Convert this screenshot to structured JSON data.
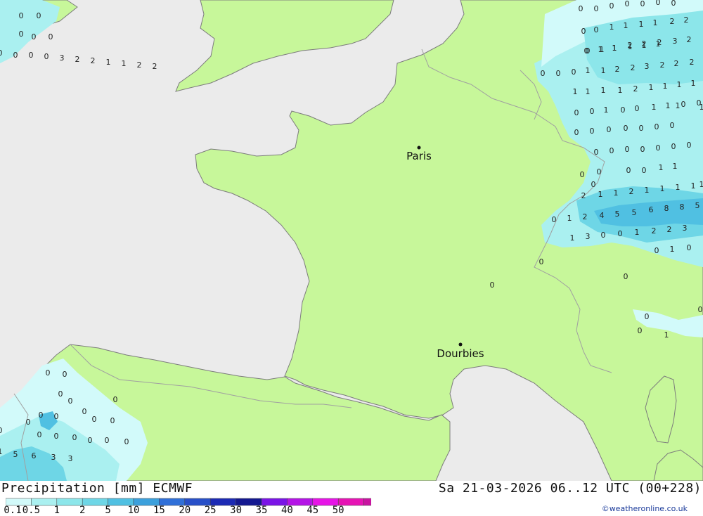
{
  "map": {
    "title": "Precipitation [mm] ECMWF",
    "run_info": "Sa 21-03-2026 06..12 UTC (00+228)",
    "credit": "©weatheronline.co.uk",
    "colors": {
      "sea": "#ebebeb",
      "land": "#c7f79a",
      "border": "#a0a0a0",
      "coast": "#7c7c7c"
    },
    "cities": [
      {
        "name": "Paris"
      },
      {
        "name": "Dourbies"
      }
    ],
    "legend": {
      "labels": [
        "0.1",
        "0.5",
        "1",
        "2",
        "5",
        "10",
        "15",
        "20",
        "25",
        "30",
        "35",
        "40",
        "45",
        "50"
      ],
      "colors": [
        "#d2fafa",
        "#aaf0f0",
        "#8ce6ea",
        "#6ed6e6",
        "#50c0e2",
        "#3ca0dc",
        "#3070d8",
        "#2850c8",
        "#1c2ab4",
        "#141890",
        "#7a14e6",
        "#b414e6",
        "#e614e6",
        "#e614b4",
        "#c814a0"
      ]
    },
    "values": [
      {
        "t": "0"
      },
      {
        "t": "0"
      },
      {
        "t": "0"
      },
      {
        "t": "0"
      },
      {
        "t": "0"
      },
      {
        "t": "0"
      },
      {
        "t": "0"
      },
      {
        "t": "0"
      },
      {
        "t": "0"
      },
      {
        "t": "1"
      },
      {
        "t": "1"
      },
      {
        "t": "1"
      },
      {
        "t": "1"
      },
      {
        "t": "0"
      },
      {
        "t": "1"
      },
      {
        "t": "1"
      },
      {
        "t": "1"
      },
      {
        "t": "1"
      },
      {
        "t": "1"
      },
      {
        "t": "2"
      },
      {
        "t": "2"
      },
      {
        "t": "0"
      },
      {
        "t": "1"
      },
      {
        "t": "1"
      },
      {
        "t": "2"
      },
      {
        "t": "2"
      },
      {
        "t": "2"
      },
      {
        "t": "3"
      },
      {
        "t": "2"
      },
      {
        "t": "0"
      },
      {
        "t": "0"
      },
      {
        "t": "0"
      },
      {
        "t": "1"
      },
      {
        "t": "1"
      },
      {
        "t": "2"
      },
      {
        "t": "2"
      },
      {
        "t": "3"
      },
      {
        "t": "2"
      },
      {
        "t": "2"
      },
      {
        "t": "2"
      },
      {
        "t": "1"
      },
      {
        "t": "1"
      },
      {
        "t": "1"
      },
      {
        "t": "1"
      },
      {
        "t": "2"
      },
      {
        "t": "1"
      },
      {
        "t": "1"
      },
      {
        "t": "1"
      },
      {
        "t": "1"
      },
      {
        "t": "1"
      },
      {
        "t": "1"
      },
      {
        "t": "0"
      },
      {
        "t": "0"
      },
      {
        "t": "1"
      },
      {
        "t": "0"
      },
      {
        "t": "0"
      },
      {
        "t": "1"
      },
      {
        "t": "1"
      },
      {
        "t": "0"
      },
      {
        "t": "0"
      },
      {
        "t": "0"
      },
      {
        "t": "0"
      },
      {
        "t": "0"
      },
      {
        "t": "0"
      },
      {
        "t": "0"
      },
      {
        "t": "0"
      },
      {
        "t": "0"
      },
      {
        "t": "0"
      },
      {
        "t": "0"
      },
      {
        "t": "0"
      },
      {
        "t": "0"
      },
      {
        "t": "0"
      },
      {
        "t": "0"
      },
      {
        "t": "0"
      },
      {
        "t": "0"
      },
      {
        "t": "0"
      },
      {
        "t": "0"
      },
      {
        "t": "0"
      },
      {
        "t": "1"
      },
      {
        "t": "1"
      },
      {
        "t": "0"
      },
      {
        "t": "2"
      },
      {
        "t": "1"
      },
      {
        "t": "1"
      },
      {
        "t": "2"
      },
      {
        "t": "1"
      },
      {
        "t": "1"
      },
      {
        "t": "1"
      },
      {
        "t": "1"
      },
      {
        "t": "1"
      },
      {
        "t": "0"
      },
      {
        "t": "1"
      },
      {
        "t": "2"
      },
      {
        "t": "4"
      },
      {
        "t": "5"
      },
      {
        "t": "5"
      },
      {
        "t": "6"
      },
      {
        "t": "8"
      },
      {
        "t": "8"
      },
      {
        "t": "5"
      },
      {
        "t": "1"
      },
      {
        "t": "3"
      },
      {
        "t": "0"
      },
      {
        "t": "0"
      },
      {
        "t": "1"
      },
      {
        "t": "2"
      },
      {
        "t": "2"
      },
      {
        "t": "3"
      },
      {
        "t": "0"
      },
      {
        "t": "0"
      },
      {
        "t": "1"
      },
      {
        "t": "0"
      },
      {
        "t": "0"
      },
      {
        "t": "0"
      },
      {
        "t": "0"
      },
      {
        "t": "1"
      },
      {
        "t": "0"
      },
      {
        "t": "0"
      },
      {
        "t": "0"
      },
      {
        "t": "0"
      },
      {
        "t": "0"
      },
      {
        "t": "0"
      },
      {
        "t": "0"
      },
      {
        "t": "0"
      },
      {
        "t": "0"
      },
      {
        "t": "0"
      },
      {
        "t": "0"
      },
      {
        "t": "0"
      },
      {
        "t": "0"
      },
      {
        "t": "0"
      },
      {
        "t": "0"
      },
      {
        "t": "0"
      },
      {
        "t": "0"
      },
      {
        "t": "0"
      },
      {
        "t": "0"
      },
      {
        "t": "0"
      },
      {
        "t": "0"
      },
      {
        "t": "0"
      },
      {
        "t": "0"
      },
      {
        "t": "0"
      },
      {
        "t": "0"
      },
      {
        "t": "0"
      },
      {
        "t": "0"
      },
      {
        "t": "0"
      },
      {
        "t": "0"
      },
      {
        "t": "3"
      },
      {
        "t": "2"
      },
      {
        "t": "2"
      },
      {
        "t": "1"
      },
      {
        "t": "1"
      },
      {
        "t": "2"
      },
      {
        "t": "2"
      },
      {
        "t": "1"
      },
      {
        "t": "5"
      },
      {
        "t": "6"
      },
      {
        "t": "3"
      },
      {
        "t": "3"
      }
    ]
  }
}
